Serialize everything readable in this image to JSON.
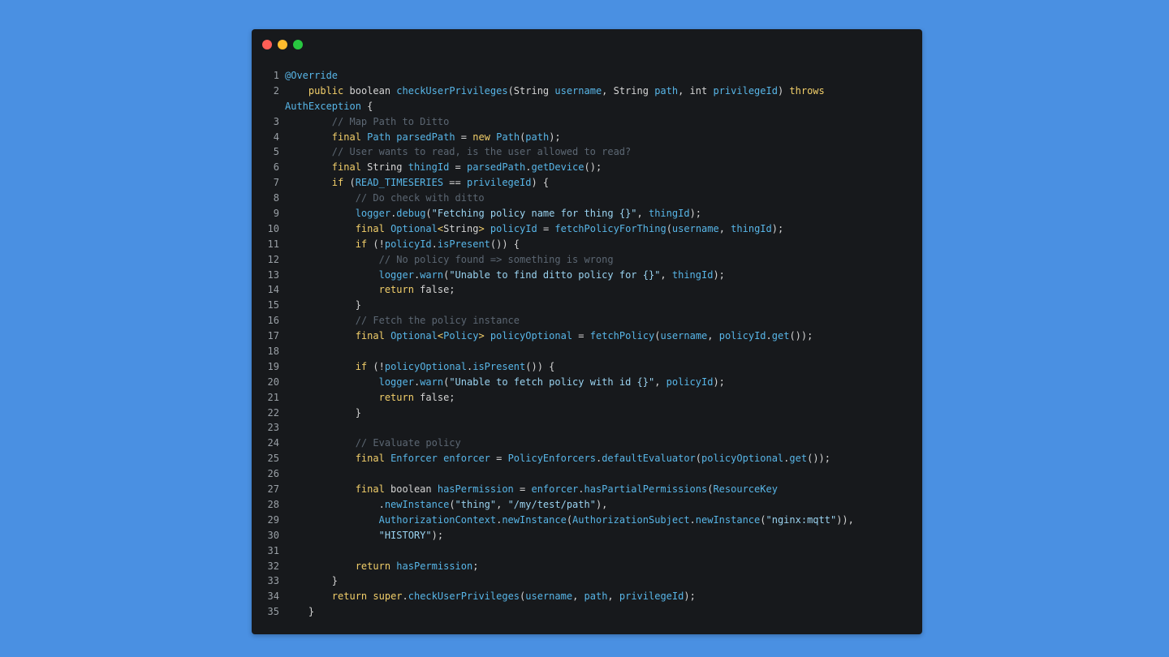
{
  "window": {
    "traffic_lights": {
      "close": "#ff5f57",
      "minimize": "#febc2e",
      "maximize": "#28c840"
    }
  },
  "code_lines": [
    {
      "n": "1",
      "tokens": [
        [
          "t-fn",
          "@Override"
        ]
      ]
    },
    {
      "n": "2",
      "tokens": [
        [
          "t-plain",
          "    "
        ],
        [
          "t-kw",
          "public"
        ],
        [
          "t-plain",
          " boolean "
        ],
        [
          "t-fn",
          "checkUserPrivileges"
        ],
        [
          "t-plain",
          "(String "
        ],
        [
          "t-var",
          "username"
        ],
        [
          "t-plain",
          ", String "
        ],
        [
          "t-var",
          "path"
        ],
        [
          "t-plain",
          ", int "
        ],
        [
          "t-var",
          "privilegeId"
        ],
        [
          "t-plain",
          ") "
        ],
        [
          "t-kw",
          "throws"
        ]
      ]
    },
    {
      "n": "",
      "tokens": [
        [
          "t-ty",
          "AuthException"
        ],
        [
          "t-plain",
          " {"
        ]
      ]
    },
    {
      "n": "3",
      "tokens": [
        [
          "t-plain",
          "        "
        ],
        [
          "t-com",
          "// Map Path to Ditto"
        ]
      ]
    },
    {
      "n": "4",
      "tokens": [
        [
          "t-plain",
          "        "
        ],
        [
          "t-kw",
          "final"
        ],
        [
          "t-plain",
          " "
        ],
        [
          "t-ty",
          "Path"
        ],
        [
          "t-plain",
          " "
        ],
        [
          "t-var",
          "parsedPath"
        ],
        [
          "t-plain",
          " = "
        ],
        [
          "t-kw",
          "new"
        ],
        [
          "t-plain",
          " "
        ],
        [
          "t-ty",
          "Path"
        ],
        [
          "t-plain",
          "("
        ],
        [
          "t-var",
          "path"
        ],
        [
          "t-plain",
          ");"
        ]
      ]
    },
    {
      "n": "5",
      "tokens": [
        [
          "t-plain",
          "        "
        ],
        [
          "t-com",
          "// User wants to read, is the user allowed to read?"
        ]
      ]
    },
    {
      "n": "6",
      "tokens": [
        [
          "t-plain",
          "        "
        ],
        [
          "t-kw",
          "final"
        ],
        [
          "t-plain",
          " String "
        ],
        [
          "t-var",
          "thingId"
        ],
        [
          "t-plain",
          " = "
        ],
        [
          "t-var",
          "parsedPath"
        ],
        [
          "t-plain",
          "."
        ],
        [
          "t-fn",
          "getDevice"
        ],
        [
          "t-plain",
          "();"
        ]
      ]
    },
    {
      "n": "7",
      "tokens": [
        [
          "t-plain",
          "        "
        ],
        [
          "t-kw",
          "if"
        ],
        [
          "t-plain",
          " ("
        ],
        [
          "t-var",
          "READ_TIMESERIES"
        ],
        [
          "t-plain",
          " == "
        ],
        [
          "t-var",
          "privilegeId"
        ],
        [
          "t-plain",
          ") {"
        ]
      ]
    },
    {
      "n": "8",
      "tokens": [
        [
          "t-plain",
          "            "
        ],
        [
          "t-com",
          "// Do check with ditto"
        ]
      ]
    },
    {
      "n": "9",
      "tokens": [
        [
          "t-plain",
          "            "
        ],
        [
          "t-var",
          "logger"
        ],
        [
          "t-plain",
          "."
        ],
        [
          "t-fn",
          "debug"
        ],
        [
          "t-plain",
          "("
        ],
        [
          "t-str",
          "\"Fetching policy name for thing {}\""
        ],
        [
          "t-plain",
          ", "
        ],
        [
          "t-var",
          "thingId"
        ],
        [
          "t-plain",
          ");"
        ]
      ]
    },
    {
      "n": "10",
      "tokens": [
        [
          "t-plain",
          "            "
        ],
        [
          "t-kw",
          "final"
        ],
        [
          "t-plain",
          " "
        ],
        [
          "t-ty",
          "Optional"
        ],
        [
          "t-kw",
          "<"
        ],
        [
          "t-plain",
          "String"
        ],
        [
          "t-kw",
          ">"
        ],
        [
          "t-plain",
          " "
        ],
        [
          "t-var",
          "policyId"
        ],
        [
          "t-plain",
          " = "
        ],
        [
          "t-fn",
          "fetchPolicyForThing"
        ],
        [
          "t-plain",
          "("
        ],
        [
          "t-var",
          "username"
        ],
        [
          "t-plain",
          ", "
        ],
        [
          "t-var",
          "thingId"
        ],
        [
          "t-plain",
          ");"
        ]
      ]
    },
    {
      "n": "11",
      "tokens": [
        [
          "t-plain",
          "            "
        ],
        [
          "t-kw",
          "if"
        ],
        [
          "t-plain",
          " (!"
        ],
        [
          "t-var",
          "policyId"
        ],
        [
          "t-plain",
          "."
        ],
        [
          "t-fn",
          "isPresent"
        ],
        [
          "t-plain",
          "()) {"
        ]
      ]
    },
    {
      "n": "12",
      "tokens": [
        [
          "t-plain",
          "                "
        ],
        [
          "t-com",
          "// No policy found => something is wrong"
        ]
      ]
    },
    {
      "n": "13",
      "tokens": [
        [
          "t-plain",
          "                "
        ],
        [
          "t-var",
          "logger"
        ],
        [
          "t-plain",
          "."
        ],
        [
          "t-fn",
          "warn"
        ],
        [
          "t-plain",
          "("
        ],
        [
          "t-str",
          "\"Unable to find ditto policy for {}\""
        ],
        [
          "t-plain",
          ", "
        ],
        [
          "t-var",
          "thingId"
        ],
        [
          "t-plain",
          ");"
        ]
      ]
    },
    {
      "n": "14",
      "tokens": [
        [
          "t-plain",
          "                "
        ],
        [
          "t-kw",
          "return"
        ],
        [
          "t-plain",
          " false;"
        ]
      ]
    },
    {
      "n": "15",
      "tokens": [
        [
          "t-plain",
          "            }"
        ]
      ]
    },
    {
      "n": "16",
      "tokens": [
        [
          "t-plain",
          "            "
        ],
        [
          "t-com",
          "// Fetch the policy instance"
        ]
      ]
    },
    {
      "n": "17",
      "tokens": [
        [
          "t-plain",
          "            "
        ],
        [
          "t-kw",
          "final"
        ],
        [
          "t-plain",
          " "
        ],
        [
          "t-ty",
          "Optional"
        ],
        [
          "t-kw",
          "<"
        ],
        [
          "t-ty",
          "Policy"
        ],
        [
          "t-kw",
          ">"
        ],
        [
          "t-plain",
          " "
        ],
        [
          "t-var",
          "policyOptional"
        ],
        [
          "t-plain",
          " = "
        ],
        [
          "t-fn",
          "fetchPolicy"
        ],
        [
          "t-plain",
          "("
        ],
        [
          "t-var",
          "username"
        ],
        [
          "t-plain",
          ", "
        ],
        [
          "t-var",
          "policyId"
        ],
        [
          "t-plain",
          "."
        ],
        [
          "t-fn",
          "get"
        ],
        [
          "t-plain",
          "());"
        ]
      ]
    },
    {
      "n": "18",
      "tokens": []
    },
    {
      "n": "19",
      "tokens": [
        [
          "t-plain",
          "            "
        ],
        [
          "t-kw",
          "if"
        ],
        [
          "t-plain",
          " (!"
        ],
        [
          "t-var",
          "policyOptional"
        ],
        [
          "t-plain",
          "."
        ],
        [
          "t-fn",
          "isPresent"
        ],
        [
          "t-plain",
          "()) {"
        ]
      ]
    },
    {
      "n": "20",
      "tokens": [
        [
          "t-plain",
          "                "
        ],
        [
          "t-var",
          "logger"
        ],
        [
          "t-plain",
          "."
        ],
        [
          "t-fn",
          "warn"
        ],
        [
          "t-plain",
          "("
        ],
        [
          "t-str",
          "\"Unable to fetch policy with id {}\""
        ],
        [
          "t-plain",
          ", "
        ],
        [
          "t-var",
          "policyId"
        ],
        [
          "t-plain",
          ");"
        ]
      ]
    },
    {
      "n": "21",
      "tokens": [
        [
          "t-plain",
          "                "
        ],
        [
          "t-kw",
          "return"
        ],
        [
          "t-plain",
          " false;"
        ]
      ]
    },
    {
      "n": "22",
      "tokens": [
        [
          "t-plain",
          "            }"
        ]
      ]
    },
    {
      "n": "23",
      "tokens": []
    },
    {
      "n": "24",
      "tokens": [
        [
          "t-plain",
          "            "
        ],
        [
          "t-com",
          "// Evaluate policy"
        ]
      ]
    },
    {
      "n": "25",
      "tokens": [
        [
          "t-plain",
          "            "
        ],
        [
          "t-kw",
          "final"
        ],
        [
          "t-plain",
          " "
        ],
        [
          "t-ty",
          "Enforcer"
        ],
        [
          "t-plain",
          " "
        ],
        [
          "t-var",
          "enforcer"
        ],
        [
          "t-plain",
          " = "
        ],
        [
          "t-ty",
          "PolicyEnforcers"
        ],
        [
          "t-plain",
          "."
        ],
        [
          "t-fn",
          "defaultEvaluator"
        ],
        [
          "t-plain",
          "("
        ],
        [
          "t-var",
          "policyOptional"
        ],
        [
          "t-plain",
          "."
        ],
        [
          "t-fn",
          "get"
        ],
        [
          "t-plain",
          "());"
        ]
      ]
    },
    {
      "n": "26",
      "tokens": []
    },
    {
      "n": "27",
      "tokens": [
        [
          "t-plain",
          "            "
        ],
        [
          "t-kw",
          "final"
        ],
        [
          "t-plain",
          " boolean "
        ],
        [
          "t-var",
          "hasPermission"
        ],
        [
          "t-plain",
          " = "
        ],
        [
          "t-var",
          "enforcer"
        ],
        [
          "t-plain",
          "."
        ],
        [
          "t-fn",
          "hasPartialPermissions"
        ],
        [
          "t-plain",
          "("
        ],
        [
          "t-ty",
          "ResourceKey"
        ]
      ]
    },
    {
      "n": "28",
      "tokens": [
        [
          "t-plain",
          "                ."
        ],
        [
          "t-fn",
          "newInstance"
        ],
        [
          "t-plain",
          "("
        ],
        [
          "t-str",
          "\"thing\""
        ],
        [
          "t-plain",
          ", "
        ],
        [
          "t-str",
          "\"/my/test/path\""
        ],
        [
          "t-plain",
          "),"
        ]
      ]
    },
    {
      "n": "29",
      "tokens": [
        [
          "t-plain",
          "                "
        ],
        [
          "t-ty",
          "AuthorizationContext"
        ],
        [
          "t-plain",
          "."
        ],
        [
          "t-fn",
          "newInstance"
        ],
        [
          "t-plain",
          "("
        ],
        [
          "t-ty",
          "AuthorizationSubject"
        ],
        [
          "t-plain",
          "."
        ],
        [
          "t-fn",
          "newInstance"
        ],
        [
          "t-plain",
          "("
        ],
        [
          "t-str",
          "\"nginx:mqtt\""
        ],
        [
          "t-plain",
          ")),"
        ]
      ]
    },
    {
      "n": "30",
      "tokens": [
        [
          "t-plain",
          "                "
        ],
        [
          "t-str",
          "\"HISTORY\""
        ],
        [
          "t-plain",
          ");"
        ]
      ]
    },
    {
      "n": "31",
      "tokens": []
    },
    {
      "n": "32",
      "tokens": [
        [
          "t-plain",
          "            "
        ],
        [
          "t-kw",
          "return"
        ],
        [
          "t-plain",
          " "
        ],
        [
          "t-var",
          "hasPermission"
        ],
        [
          "t-plain",
          ";"
        ]
      ]
    },
    {
      "n": "33",
      "tokens": [
        [
          "t-plain",
          "        }"
        ]
      ]
    },
    {
      "n": "34",
      "tokens": [
        [
          "t-plain",
          "        "
        ],
        [
          "t-kw",
          "return"
        ],
        [
          "t-plain",
          " "
        ],
        [
          "t-kw",
          "super"
        ],
        [
          "t-plain",
          "."
        ],
        [
          "t-fn",
          "checkUserPrivileges"
        ],
        [
          "t-plain",
          "("
        ],
        [
          "t-var",
          "username"
        ],
        [
          "t-plain",
          ", "
        ],
        [
          "t-var",
          "path"
        ],
        [
          "t-plain",
          ", "
        ],
        [
          "t-var",
          "privilegeId"
        ],
        [
          "t-plain",
          ");"
        ]
      ]
    },
    {
      "n": "35",
      "tokens": [
        [
          "t-plain",
          "    }"
        ]
      ]
    }
  ]
}
